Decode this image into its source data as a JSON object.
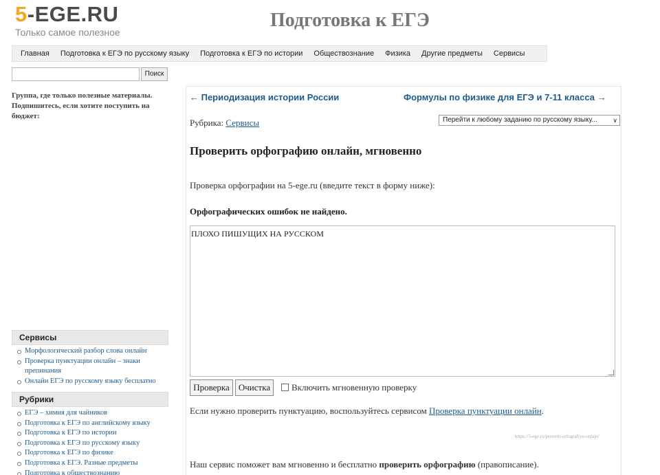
{
  "header": {
    "logo_number": "5",
    "logo_rest": "-EGE.RU",
    "logo_tagline": "Только самое полезное",
    "site_title": "Подготовка к ЕГЭ"
  },
  "nav": {
    "items": [
      "Главная",
      "Подготовка к ЕГЭ по русскому языку",
      "Подготовка к ЕГЭ по истории",
      "Обществознание",
      "Физика",
      "Другие предметы",
      "Сервисы"
    ]
  },
  "search": {
    "value": "",
    "button_label": "Поиск"
  },
  "sidebar": {
    "group_text": "Группа, где только полезные материалы. Подпишитесь, если хотите поступить на бюджет:",
    "services_title": "Сервисы",
    "services": [
      "Морфологический разбор слова онлайн",
      "Проверка пунктуации онлайн – знаки препинания",
      "Онлайн ЕГЭ по русскому языку бесплатно"
    ],
    "rubrics_title": "Рубрики",
    "rubrics": [
      "ЕГЭ – химия для чайников",
      "Подготовка к ЕГЭ по английскому языку",
      "Подготовка к ЕГЭ по истории",
      "Подготовка к ЕГЭ по русскому языку",
      "Подготовка к ЕГЭ по физике",
      "Подготовка к ЕГЭ. Разные предметы",
      "Подготовка к обществознанию"
    ]
  },
  "main": {
    "prev_link": "← Периодизация истории России",
    "next_link": "Формулы по физике для ЕГЭ и 7-11 класса →",
    "rubric_label": "Рубрика:",
    "rubric_link": "Сервисы",
    "task_select": "Перейти к любому заданию по русскому языку...",
    "title": "Проверить орфографию онлайн, мгновенно",
    "intro": "Проверка орфографии на 5-ege.ru (введите текст в форму ниже):",
    "result": "Орфографических ошибок не найдено.",
    "textarea_value": "ПЛОХО ПИШУЩИХ НА РУССКОМ",
    "check_button": "Проверка",
    "clear_button": "Очистка",
    "instant_checkbox_label": "Включить мгновенную проверку",
    "punct_text": "Если нужно проверить пунктуацию, воспользуйтесь сервисом",
    "punct_link": "Проверка пунктуации онлайн",
    "url_note": "https://5-ege.ru/proverit-orfografiyu-onlajn/",
    "bottom_before": "Наш сервис поможет вам мгновенно и бесплатно",
    "bottom_bold": "проверить орфографию",
    "bottom_after": "(правописание)."
  }
}
